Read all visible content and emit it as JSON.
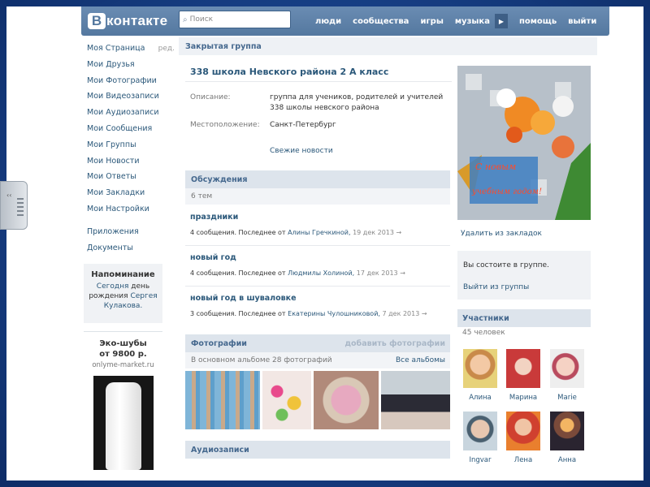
{
  "header": {
    "logo_letter": "В",
    "logo_text": "контакте",
    "search_placeholder": "Поиск",
    "nav": [
      "люди",
      "сообщества",
      "игры",
      "музыка",
      "помощь",
      "выйти"
    ]
  },
  "sidebar": {
    "items": [
      {
        "label": "Моя Страница",
        "edit": "ред."
      },
      {
        "label": "Мои Друзья"
      },
      {
        "label": "Мои Фотографии"
      },
      {
        "label": "Мои Видеозаписи"
      },
      {
        "label": "Мои Аудиозаписи"
      },
      {
        "label": "Мои Сообщения"
      },
      {
        "label": "Мои Группы"
      },
      {
        "label": "Мои Новости"
      },
      {
        "label": "Мои Ответы"
      },
      {
        "label": "Мои Закладки"
      },
      {
        "label": "Мои Настройки"
      }
    ],
    "extra": [
      "Приложения",
      "Документы"
    ],
    "reminder": {
      "title": "Напоминание",
      "w1": "Сегодня",
      "w2": "день",
      "w3": "рождения",
      "name1": "Сергея",
      "name2": "Кулакова."
    },
    "ad": {
      "title_line1": "Эко-шубы",
      "title_line2": "от 9800 р.",
      "site": "onlyme-market.ru"
    }
  },
  "group": {
    "header": "Закрытая группа",
    "title": "338 школа Невского района 2 А класс",
    "description_label": "Описание:",
    "description": "группа для учеников, родителей и учителей 338 школы невского района",
    "location_label": "Местоположение:",
    "location": "Санкт-Петербург",
    "news_link": "Свежие новости"
  },
  "discussions": {
    "title": "Обсуждения",
    "count": "6 тем",
    "topics": [
      {
        "title": "праздники",
        "meta": "4 сообщения. Последнее от",
        "author": "Алины Гречкиной,",
        "date": "19 дек 2013",
        "arrow": "→"
      },
      {
        "title": "новый год",
        "meta": "4 сообщения. Последнее от",
        "author": "Людмилы Холиной,",
        "date": "17 дек 2013",
        "arrow": "→"
      },
      {
        "title": "новый год в шуваловке",
        "meta": "3 сообщения. Последнее от",
        "author": "Екатерины Чулошниковой,",
        "date": "7 дек 2013",
        "arrow": "→"
      }
    ]
  },
  "photos": {
    "title": "Фотографии",
    "add": "добавить фотографии",
    "album_info": "В основном альбоме 28 фотографий",
    "all_albums": "Все альбомы"
  },
  "audio": {
    "title": "Аудиозаписи"
  },
  "right": {
    "image_caption1": "С новым",
    "image_caption2": "учебным годом!",
    "bookmark": "Удалить из закладок",
    "status": "Вы состоите в группе.",
    "leave": "Выйти из группы",
    "members_title": "Участники",
    "members_count": "45 человек",
    "members": [
      "Алина",
      "Марина",
      "Marie",
      "Ingvar",
      "Лена",
      "Анна"
    ]
  },
  "colors": {
    "header_bg": "#5b7fa6",
    "link": "#2b587a",
    "section_bg": "#dde4ec",
    "slide_bg": "#173f85"
  }
}
